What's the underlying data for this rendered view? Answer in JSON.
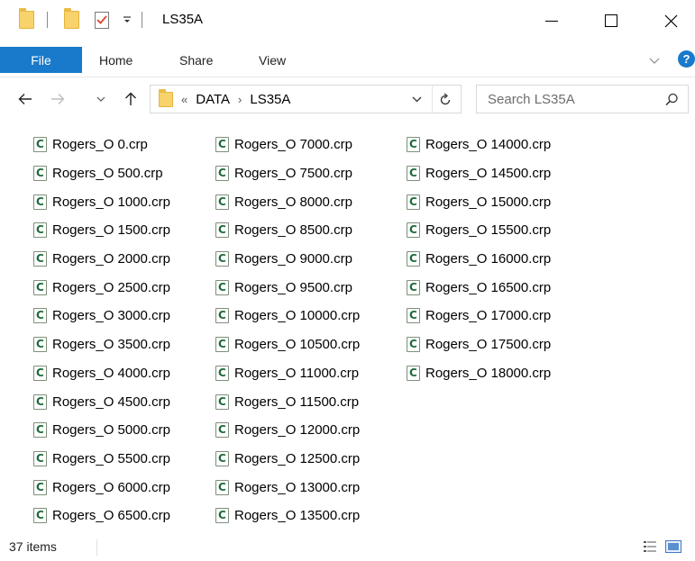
{
  "window": {
    "title": "LS35A"
  },
  "ribbon": {
    "tabs": [
      "File",
      "Home",
      "Share",
      "View"
    ],
    "help_glyph": "?"
  },
  "address": {
    "crumb_overflow": "«",
    "crumbs": [
      "DATA",
      "LS35A"
    ],
    "separator": "›"
  },
  "search": {
    "placeholder": "Search LS35A"
  },
  "files": {
    "columns": [
      [
        "Rogers_O 0.crp",
        "Rogers_O 500.crp",
        "Rogers_O 1000.crp",
        "Rogers_O 1500.crp",
        "Rogers_O 2000.crp",
        "Rogers_O 2500.crp",
        "Rogers_O 3000.crp",
        "Rogers_O 3500.crp",
        "Rogers_O 4000.crp",
        "Rogers_O 4500.crp",
        "Rogers_O 5000.crp",
        "Rogers_O 5500.crp",
        "Rogers_O 6000.crp",
        "Rogers_O 6500.crp"
      ],
      [
        "Rogers_O 7000.crp",
        "Rogers_O 7500.crp",
        "Rogers_O 8000.crp",
        "Rogers_O 8500.crp",
        "Rogers_O 9000.crp",
        "Rogers_O 9500.crp",
        "Rogers_O 10000.crp",
        "Rogers_O 10500.crp",
        "Rogers_O 11000.crp",
        "Rogers_O 11500.crp",
        "Rogers_O 12000.crp",
        "Rogers_O 12500.crp",
        "Rogers_O 13000.crp",
        "Rogers_O 13500.crp"
      ],
      [
        "Rogers_O 14000.crp",
        "Rogers_O 14500.crp",
        "Rogers_O 15000.crp",
        "Rogers_O 15500.crp",
        "Rogers_O 16000.crp",
        "Rogers_O 16500.crp",
        "Rogers_O 17000.crp",
        "Rogers_O 17500.crp",
        "Rogers_O 18000.crp"
      ]
    ]
  },
  "status": {
    "item_count": "37 items"
  },
  "colors": {
    "accent": "#1979ca",
    "folder": "#f8d26a",
    "file_icon": "#1d6b3a"
  },
  "icons": [
    "folder-icon",
    "properties-icon",
    "customize-dropdown-icon",
    "minimize-icon",
    "maximize-icon",
    "close-icon",
    "ribbon-expand-icon",
    "help-icon",
    "back-icon",
    "forward-icon",
    "recent-locations-icon",
    "up-icon",
    "address-dropdown-icon",
    "refresh-icon",
    "search-icon",
    "details-view-icon",
    "large-icons-view-icon",
    "crp-file-icon"
  ]
}
